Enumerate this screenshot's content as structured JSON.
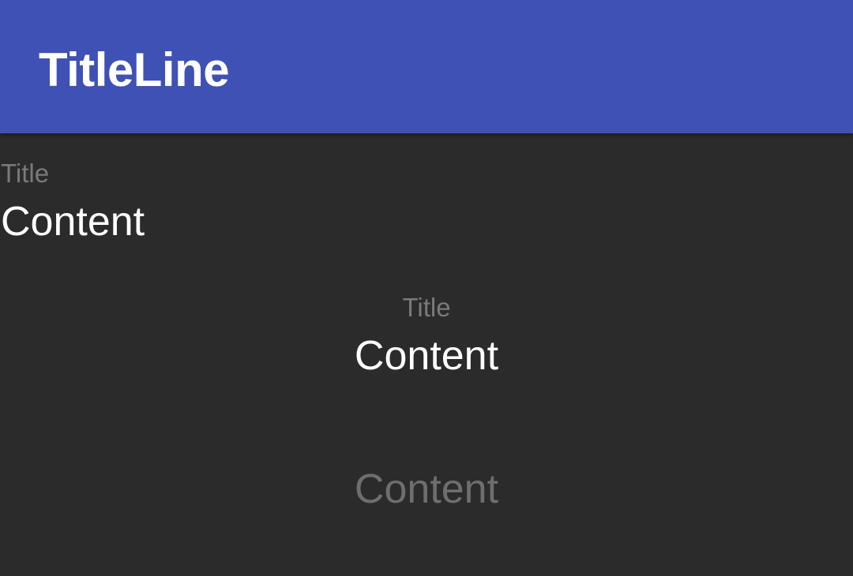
{
  "app_bar": {
    "title": "TitleLine",
    "color": "#3f51b5"
  },
  "rows": [
    {
      "title": "Title",
      "content": "Content",
      "align": "left"
    },
    {
      "title": "Title",
      "content": "Content",
      "align": "center"
    },
    {
      "content": "Content",
      "align": "center",
      "state": "dimmed"
    }
  ],
  "colors": {
    "background": "#2b2b2b",
    "title_text": "#7a7a7a",
    "content_text": "#ffffff",
    "dimmed_text": "#6e6e6e"
  }
}
